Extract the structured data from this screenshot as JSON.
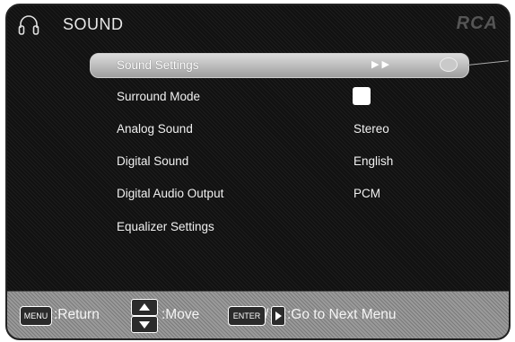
{
  "header": {
    "title": "SOUND",
    "brand": "RCA",
    "icon": "headphones-icon"
  },
  "menu": {
    "items": [
      {
        "label": "Sound Settings",
        "value": "",
        "selected": true
      },
      {
        "label": "Surround Mode",
        "value": "",
        "checkbox": true
      },
      {
        "label": "Analog Sound",
        "value": "Stereo"
      },
      {
        "label": "Digital Sound",
        "value": "English"
      },
      {
        "label": "Digital Audio Output",
        "value": "PCM"
      },
      {
        "label": "Equalizer Settings",
        "value": ""
      }
    ]
  },
  "footer": {
    "menu_key": "MENU",
    "return_text": ":Return",
    "move_text": ":Move",
    "enter_key": "ENTER",
    "slash": "/",
    "next_text": ":Go to Next Menu"
  },
  "colors": {
    "background": "#111111",
    "highlight": "#bdbdbd",
    "footer": "#8a8a8a"
  }
}
